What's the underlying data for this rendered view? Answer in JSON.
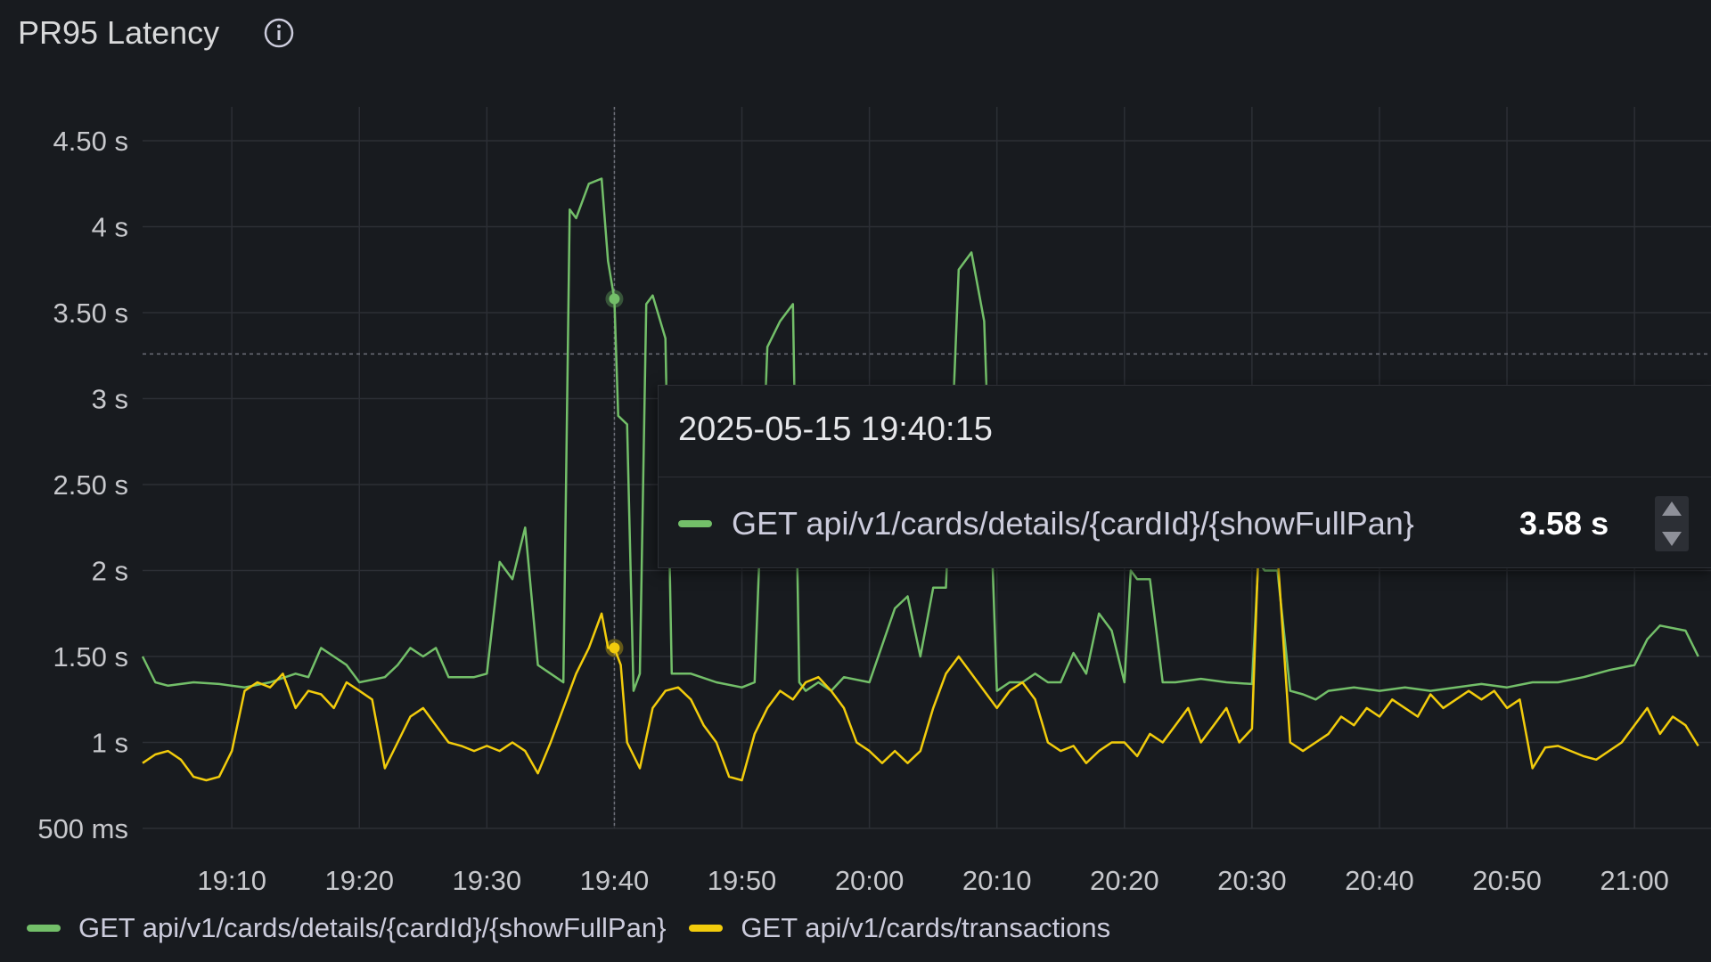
{
  "panel": {
    "title": "PR95 Latency",
    "info_icon": "info-circle-icon"
  },
  "colors": {
    "background": "#181b1f",
    "grid": "#2c2f35",
    "series_green": "#73bf69",
    "series_yellow": "#f2cc0c"
  },
  "tooltip": {
    "time": "2025-05-15 19:40:15",
    "series": "GET api/v1/cards/details/{cardId}/{showFullPan}",
    "value": "3.58 s"
  },
  "chart_data": {
    "type": "line",
    "x_unit": "time (HH:MM, 2025-05-15)",
    "y_unit": "seconds",
    "ylim": [
      0.5,
      4.5
    ],
    "xlim": [
      "19:03",
      "21:06"
    ],
    "y_ticks": [
      {
        "value": 4.5,
        "label": "4.50 s"
      },
      {
        "value": 4.0,
        "label": "4 s"
      },
      {
        "value": 3.5,
        "label": "3.50 s"
      },
      {
        "value": 3.0,
        "label": "3 s"
      },
      {
        "value": 2.5,
        "label": "2.50 s"
      },
      {
        "value": 2.0,
        "label": "2 s"
      },
      {
        "value": 1.5,
        "label": "1.50 s"
      },
      {
        "value": 1.0,
        "label": "1 s"
      },
      {
        "value": 0.5,
        "label": "500 ms"
      }
    ],
    "x_ticks": [
      {
        "value": "19:10",
        "label": "19:10"
      },
      {
        "value": "19:20",
        "label": "19:20"
      },
      {
        "value": "19:30",
        "label": "19:30"
      },
      {
        "value": "19:40",
        "label": "19:40"
      },
      {
        "value": "19:50",
        "label": "19:50"
      },
      {
        "value": "20:00",
        "label": "20:00"
      },
      {
        "value": "20:10",
        "label": "20:10"
      },
      {
        "value": "20:20",
        "label": "20:20"
      },
      {
        "value": "20:30",
        "label": "20:30"
      },
      {
        "value": "20:40",
        "label": "20:40"
      },
      {
        "value": "20:50",
        "label": "20:50"
      },
      {
        "value": "21:00",
        "label": "21:00"
      }
    ],
    "hover_time": "19:40",
    "hover_value": 3.26,
    "grid": true,
    "legend_position": "bottom-left",
    "series": [
      {
        "name": "GET api/v1/cards/details/{cardId}/{showFullPan}",
        "color": "#73bf69",
        "points": [
          [
            "19:03",
            1.5
          ],
          [
            "19:04",
            1.35
          ],
          [
            "19:05",
            1.33
          ],
          [
            "19:07",
            1.35
          ],
          [
            "19:09",
            1.34
          ],
          [
            "19:11",
            1.32
          ],
          [
            "19:13",
            1.35
          ],
          [
            "19:15",
            1.4
          ],
          [
            "19:16",
            1.38
          ],
          [
            "19:17",
            1.55
          ],
          [
            "19:18",
            1.5
          ],
          [
            "19:19",
            1.45
          ],
          [
            "19:20",
            1.35
          ],
          [
            "19:22",
            1.38
          ],
          [
            "19:23",
            1.45
          ],
          [
            "19:24",
            1.55
          ],
          [
            "19:25",
            1.5
          ],
          [
            "19:26",
            1.55
          ],
          [
            "19:27",
            1.38
          ],
          [
            "19:29",
            1.38
          ],
          [
            "19:30",
            1.4
          ],
          [
            "19:31",
            2.05
          ],
          [
            "19:32",
            1.95
          ],
          [
            "19:33",
            2.25
          ],
          [
            "19:34",
            1.45
          ],
          [
            "19:35",
            1.4
          ],
          [
            "19:36",
            1.35
          ],
          [
            "19:36.5",
            4.1
          ],
          [
            "19:37",
            4.05
          ],
          [
            "19:38",
            4.25
          ],
          [
            "19:39",
            4.28
          ],
          [
            "19:39.5",
            3.8
          ],
          [
            "19:40",
            3.58
          ],
          [
            "19:40.3",
            2.9
          ],
          [
            "19:41",
            2.85
          ],
          [
            "19:41.5",
            1.3
          ],
          [
            "19:42",
            1.4
          ],
          [
            "19:42.5",
            3.55
          ],
          [
            "19:43",
            3.6
          ],
          [
            "19:44",
            3.35
          ],
          [
            "19:44.5",
            1.4
          ],
          [
            "19:45",
            1.4
          ],
          [
            "19:46",
            1.4
          ],
          [
            "19:48",
            1.35
          ],
          [
            "19:50",
            1.32
          ],
          [
            "19:51",
            1.35
          ],
          [
            "19:52",
            3.3
          ],
          [
            "19:53",
            3.45
          ],
          [
            "19:54",
            3.55
          ],
          [
            "19:54.5",
            1.35
          ],
          [
            "19:55",
            1.3
          ],
          [
            "19:56",
            1.35
          ],
          [
            "19:57",
            1.3
          ],
          [
            "19:58",
            1.38
          ],
          [
            "20:00",
            1.35
          ],
          [
            "20:02",
            1.78
          ],
          [
            "20:03",
            1.85
          ],
          [
            "20:04",
            1.5
          ],
          [
            "20:05",
            1.9
          ],
          [
            "20:06",
            1.9
          ],
          [
            "20:07",
            3.75
          ],
          [
            "20:08",
            3.85
          ],
          [
            "20:09",
            3.45
          ],
          [
            "20:10",
            1.3
          ],
          [
            "20:11",
            1.35
          ],
          [
            "20:12",
            1.35
          ],
          [
            "20:13",
            1.4
          ],
          [
            "20:14",
            1.35
          ],
          [
            "20:15",
            1.35
          ],
          [
            "20:16",
            1.52
          ],
          [
            "20:17",
            1.4
          ],
          [
            "20:18",
            1.75
          ],
          [
            "20:19",
            1.65
          ],
          [
            "20:20",
            1.35
          ],
          [
            "20:20.5",
            2.0
          ],
          [
            "20:21",
            1.95
          ],
          [
            "20:22",
            1.95
          ],
          [
            "20:23",
            1.35
          ],
          [
            "20:24",
            1.35
          ],
          [
            "20:26",
            1.37
          ],
          [
            "20:28",
            1.35
          ],
          [
            "20:30",
            1.34
          ],
          [
            "20:30.5",
            2.05
          ],
          [
            "20:31",
            2.0
          ],
          [
            "20:32",
            2.0
          ],
          [
            "20:33",
            1.3
          ],
          [
            "20:34",
            1.28
          ],
          [
            "20:35",
            1.25
          ],
          [
            "20:36",
            1.3
          ],
          [
            "20:38",
            1.32
          ],
          [
            "20:40",
            1.3
          ],
          [
            "20:42",
            1.32
          ],
          [
            "20:44",
            1.3
          ],
          [
            "20:46",
            1.32
          ],
          [
            "20:48",
            1.34
          ],
          [
            "20:50",
            1.32
          ],
          [
            "20:52",
            1.35
          ],
          [
            "20:54",
            1.35
          ],
          [
            "20:56",
            1.38
          ],
          [
            "20:58",
            1.42
          ],
          [
            "21:00",
            1.45
          ],
          [
            "21:01",
            1.6
          ],
          [
            "21:02",
            1.68
          ],
          [
            "21:04",
            1.65
          ],
          [
            "21:05",
            1.5
          ]
        ]
      },
      {
        "name": "GET api/v1/cards/transactions",
        "color": "#f2cc0c",
        "points": [
          [
            "19:03",
            0.88
          ],
          [
            "19:04",
            0.93
          ],
          [
            "19:05",
            0.95
          ],
          [
            "19:06",
            0.9
          ],
          [
            "19:07",
            0.8
          ],
          [
            "19:08",
            0.78
          ],
          [
            "19:09",
            0.8
          ],
          [
            "19:10",
            0.95
          ],
          [
            "19:11",
            1.3
          ],
          [
            "19:12",
            1.35
          ],
          [
            "19:13",
            1.32
          ],
          [
            "19:14",
            1.4
          ],
          [
            "19:15",
            1.2
          ],
          [
            "19:16",
            1.3
          ],
          [
            "19:17",
            1.28
          ],
          [
            "19:18",
            1.2
          ],
          [
            "19:19",
            1.35
          ],
          [
            "19:20",
            1.3
          ],
          [
            "19:21",
            1.25
          ],
          [
            "19:22",
            0.85
          ],
          [
            "19:23",
            1.0
          ],
          [
            "19:24",
            1.15
          ],
          [
            "19:25",
            1.2
          ],
          [
            "19:26",
            1.1
          ],
          [
            "19:27",
            1.0
          ],
          [
            "19:28",
            0.98
          ],
          [
            "19:29",
            0.95
          ],
          [
            "19:30",
            0.98
          ],
          [
            "19:31",
            0.95
          ],
          [
            "19:32",
            1.0
          ],
          [
            "19:33",
            0.95
          ],
          [
            "19:34",
            0.82
          ],
          [
            "19:35",
            1.0
          ],
          [
            "19:36",
            1.2
          ],
          [
            "19:37",
            1.4
          ],
          [
            "19:38",
            1.55
          ],
          [
            "19:39",
            1.75
          ],
          [
            "19:39.5",
            1.55
          ],
          [
            "19:40",
            1.55
          ],
          [
            "19:40.5",
            1.45
          ],
          [
            "19:41",
            1.0
          ],
          [
            "19:42",
            0.85
          ],
          [
            "19:43",
            1.2
          ],
          [
            "19:44",
            1.3
          ],
          [
            "19:45",
            1.32
          ],
          [
            "19:46",
            1.25
          ],
          [
            "19:47",
            1.1
          ],
          [
            "19:48",
            1.0
          ],
          [
            "19:49",
            0.8
          ],
          [
            "19:50",
            0.78
          ],
          [
            "19:51",
            1.05
          ],
          [
            "19:52",
            1.2
          ],
          [
            "19:53",
            1.3
          ],
          [
            "19:54",
            1.25
          ],
          [
            "19:55",
            1.35
          ],
          [
            "19:56",
            1.38
          ],
          [
            "19:57",
            1.3
          ],
          [
            "19:58",
            1.2
          ],
          [
            "19:59",
            1.0
          ],
          [
            "20:00",
            0.95
          ],
          [
            "20:01",
            0.88
          ],
          [
            "20:02",
            0.95
          ],
          [
            "20:03",
            0.88
          ],
          [
            "20:04",
            0.95
          ],
          [
            "20:05",
            1.2
          ],
          [
            "20:06",
            1.4
          ],
          [
            "20:07",
            1.5
          ],
          [
            "20:08",
            1.4
          ],
          [
            "20:09",
            1.3
          ],
          [
            "20:10",
            1.2
          ],
          [
            "20:11",
            1.3
          ],
          [
            "20:12",
            1.35
          ],
          [
            "20:13",
            1.25
          ],
          [
            "20:14",
            1.0
          ],
          [
            "20:15",
            0.95
          ],
          [
            "20:16",
            0.98
          ],
          [
            "20:17",
            0.88
          ],
          [
            "20:18",
            0.95
          ],
          [
            "20:19",
            1.0
          ],
          [
            "20:20",
            1.0
          ],
          [
            "20:21",
            0.92
          ],
          [
            "20:22",
            1.05
          ],
          [
            "20:23",
            1.0
          ],
          [
            "20:24",
            1.1
          ],
          [
            "20:25",
            1.2
          ],
          [
            "20:26",
            1.0
          ],
          [
            "20:27",
            1.1
          ],
          [
            "20:28",
            1.2
          ],
          [
            "20:29",
            1.0
          ],
          [
            "20:30",
            1.08
          ],
          [
            "20:30.5",
            2.1
          ],
          [
            "20:31",
            2.1
          ],
          [
            "20:32",
            2.1
          ],
          [
            "20:33",
            1.0
          ],
          [
            "20:34",
            0.95
          ],
          [
            "20:35",
            1.0
          ],
          [
            "20:36",
            1.05
          ],
          [
            "20:37",
            1.15
          ],
          [
            "20:38",
            1.1
          ],
          [
            "20:39",
            1.2
          ],
          [
            "20:40",
            1.15
          ],
          [
            "20:41",
            1.25
          ],
          [
            "20:42",
            1.2
          ],
          [
            "20:43",
            1.15
          ],
          [
            "20:44",
            1.28
          ],
          [
            "20:45",
            1.2
          ],
          [
            "20:46",
            1.25
          ],
          [
            "20:47",
            1.3
          ],
          [
            "20:48",
            1.25
          ],
          [
            "20:49",
            1.3
          ],
          [
            "20:50",
            1.2
          ],
          [
            "20:51",
            1.25
          ],
          [
            "20:52",
            0.85
          ],
          [
            "20:53",
            0.97
          ],
          [
            "20:54",
            0.98
          ],
          [
            "20:55",
            0.95
          ],
          [
            "20:56",
            0.92
          ],
          [
            "20:57",
            0.9
          ],
          [
            "20:58",
            0.95
          ],
          [
            "20:59",
            1.0
          ],
          [
            "21:00",
            1.1
          ],
          [
            "21:01",
            1.2
          ],
          [
            "21:02",
            1.05
          ],
          [
            "21:03",
            1.15
          ],
          [
            "21:04",
            1.1
          ],
          [
            "21:05",
            0.98
          ]
        ]
      }
    ]
  },
  "legend": {
    "items": [
      {
        "label": "GET api/v1/cards/details/{cardId}/{showFullPan}",
        "color": "#73bf69"
      },
      {
        "label": "GET api/v1/cards/transactions",
        "color": "#f2cc0c"
      }
    ]
  }
}
